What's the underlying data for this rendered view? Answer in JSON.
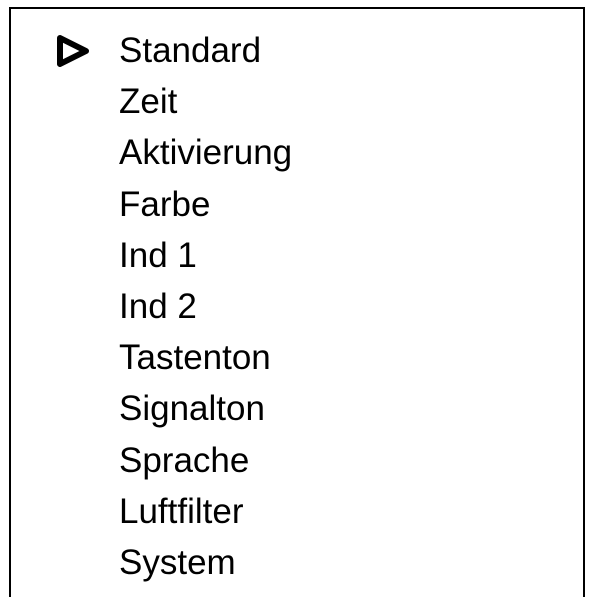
{
  "menu": {
    "selected_index": 0,
    "selection_icon": "play-triangle-icon",
    "items": [
      {
        "label": "Standard"
      },
      {
        "label": "Zeit"
      },
      {
        "label": "Aktivierung"
      },
      {
        "label": "Farbe"
      },
      {
        "label": "Ind 1"
      },
      {
        "label": "Ind 2"
      },
      {
        "label": "Tastenton"
      },
      {
        "label": "Signalton"
      },
      {
        "label": "Sprache"
      },
      {
        "label": "Luftfilter"
      },
      {
        "label": "System"
      }
    ]
  }
}
